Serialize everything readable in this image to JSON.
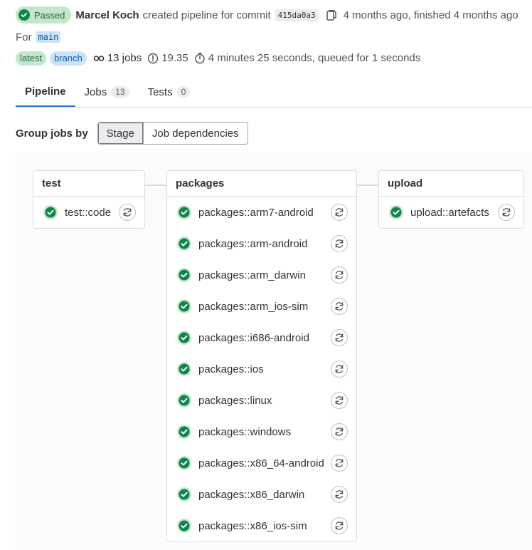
{
  "pipeline": {
    "status": "Passed",
    "author": "Marcel Koch",
    "action_text": "created pipeline for commit",
    "commit_sha": "415da0a3",
    "time_text": "4 months ago, finished 4 months ago",
    "for_label": "For",
    "ref": "main",
    "badges": [
      "latest",
      "branch"
    ],
    "jobs_count": "13 jobs",
    "compute": "19.35",
    "duration": "4 minutes 25 seconds, queued for 1 seconds"
  },
  "tabs": [
    {
      "label": "Pipeline"
    },
    {
      "label": "Jobs",
      "count": "13"
    },
    {
      "label": "Tests",
      "count": "0"
    }
  ],
  "group_by": {
    "label": "Group jobs by",
    "options": [
      "Stage",
      "Job dependencies"
    ],
    "selected": "Stage"
  },
  "stages": [
    {
      "name": "test",
      "jobs": [
        "test::code"
      ]
    },
    {
      "name": "packages",
      "jobs": [
        "packages::arm7-android",
        "packages::arm-android",
        "packages::arm_darwin",
        "packages::arm_ios-sim",
        "packages::i686-android",
        "packages::ios",
        "packages::linux",
        "packages::windows",
        "packages::x86_64-android",
        "packages::x86_darwin",
        "packages::x86_ios-sim"
      ]
    },
    {
      "name": "upload",
      "jobs": [
        "upload::artefacts"
      ]
    }
  ],
  "colors": {
    "success": "#108548",
    "link": "#1f75cb",
    "accent_tab": "#1f75cb"
  }
}
